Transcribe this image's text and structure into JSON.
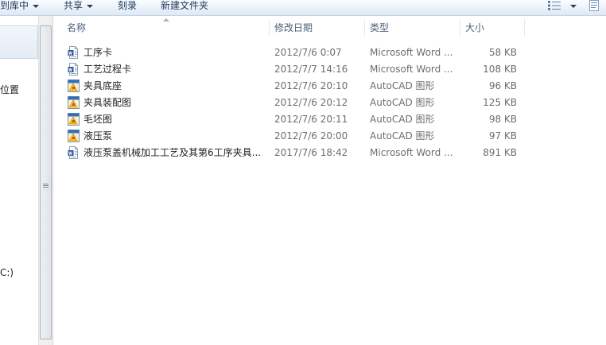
{
  "toolbar": {
    "include_in_library": "到库中",
    "share": "共享",
    "burn": "刻录",
    "new_folder": "新建文件夹"
  },
  "nav": {
    "partial_item_1": "位置",
    "partial_item_2": "C:)"
  },
  "columns": {
    "name": "名称",
    "date": "修改日期",
    "type": "类型",
    "size": "大小"
  },
  "files": [
    {
      "name": "工序卡",
      "date": "2012/7/6 0:07",
      "type": "Microsoft Word ...",
      "size": "58 KB",
      "icon": "word-doc-icon"
    },
    {
      "name": "工艺过程卡",
      "date": "2012/7/7 14:16",
      "type": "Microsoft Word ...",
      "size": "108 KB",
      "icon": "word-doc-icon"
    },
    {
      "name": "夹具底座",
      "date": "2012/7/6 20:10",
      "type": "AutoCAD 图形",
      "size": "96 KB",
      "icon": "autocad-dwg-icon"
    },
    {
      "name": "夹具装配图",
      "date": "2012/7/6 20:12",
      "type": "AutoCAD 图形",
      "size": "125 KB",
      "icon": "autocad-dwg-icon"
    },
    {
      "name": "毛坯图",
      "date": "2012/7/6 20:11",
      "type": "AutoCAD 图形",
      "size": "98 KB",
      "icon": "autocad-dwg-icon"
    },
    {
      "name": "液压泵",
      "date": "2012/7/6 20:00",
      "type": "AutoCAD 图形",
      "size": "97 KB",
      "icon": "autocad-dwg-icon"
    },
    {
      "name": "液压泵盖机械加工工艺及其第6工序夹具...",
      "date": "2017/7/6 18:42",
      "type": "Microsoft Word ...",
      "size": "891 KB",
      "icon": "word-doc-icon"
    }
  ],
  "colors": {
    "toolbar_text": "#1e395b",
    "header_text": "#4c607a",
    "detail_text": "#6d6d6d"
  }
}
